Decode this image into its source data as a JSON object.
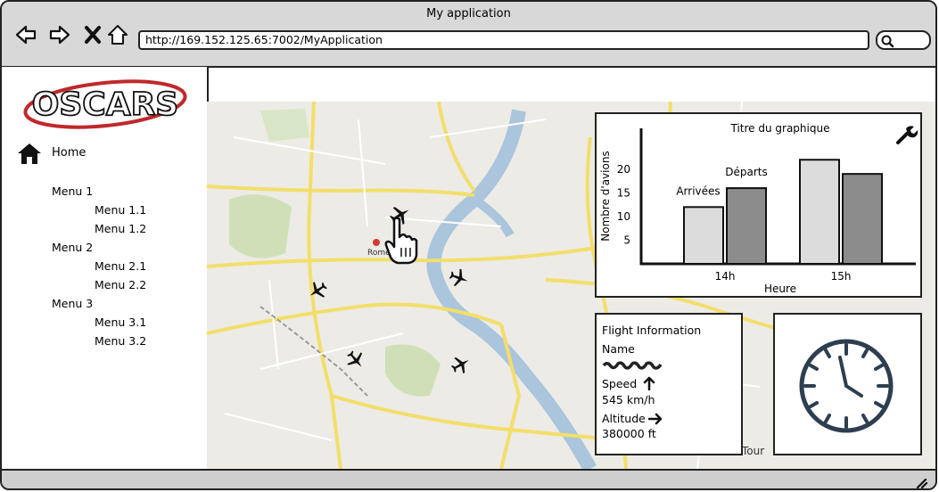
{
  "window": {
    "title": "My application",
    "url": "http://169.152.125.65:7002/MyApplication"
  },
  "sidebar": {
    "logo_text": "OSCARS",
    "home_label": "Home",
    "menus": [
      {
        "label": "Menu 1",
        "items": [
          {
            "label": "Menu 1.1"
          },
          {
            "label": "Menu 1.2"
          }
        ]
      },
      {
        "label": "Menu 2",
        "items": [
          {
            "label": "Menu 2.1"
          },
          {
            "label": "Menu 2.2"
          }
        ]
      },
      {
        "label": "Menu 3",
        "items": [
          {
            "label": "Menu 3.1"
          },
          {
            "label": "Menu 3.2"
          }
        ]
      }
    ]
  },
  "map": {
    "city_label": "Rome",
    "tour_label": "Tour",
    "planes": 5
  },
  "chart_data": {
    "type": "bar",
    "title": "Titre du graphique",
    "xlabel": "Heure",
    "ylabel": "Nombre d'avions",
    "categories": [
      "14h",
      "15h"
    ],
    "series": [
      {
        "name": "Arrivées",
        "values": [
          12,
          22
        ]
      },
      {
        "name": "Départs",
        "values": [
          16,
          19
        ]
      }
    ],
    "yticks": [
      5,
      10,
      15,
      20
    ],
    "ylim": [
      0,
      26
    ],
    "colors": [
      "#dcdcdc",
      "#8c8c8c"
    ]
  },
  "flight": {
    "header": "Flight Information",
    "name_label": "Name",
    "speed_label": "Speed",
    "speed_value": "545 km/h",
    "altitude_label": "Altitude",
    "altitude_value": "380000 ft"
  },
  "icons": {
    "back": "arrow-left-icon",
    "forward": "arrow-right-icon",
    "stop": "close-icon",
    "home": "home-icon",
    "search": "search-icon",
    "settings": "wrench-icon",
    "clock": "clock-icon",
    "resize": "resize-grip-icon"
  }
}
